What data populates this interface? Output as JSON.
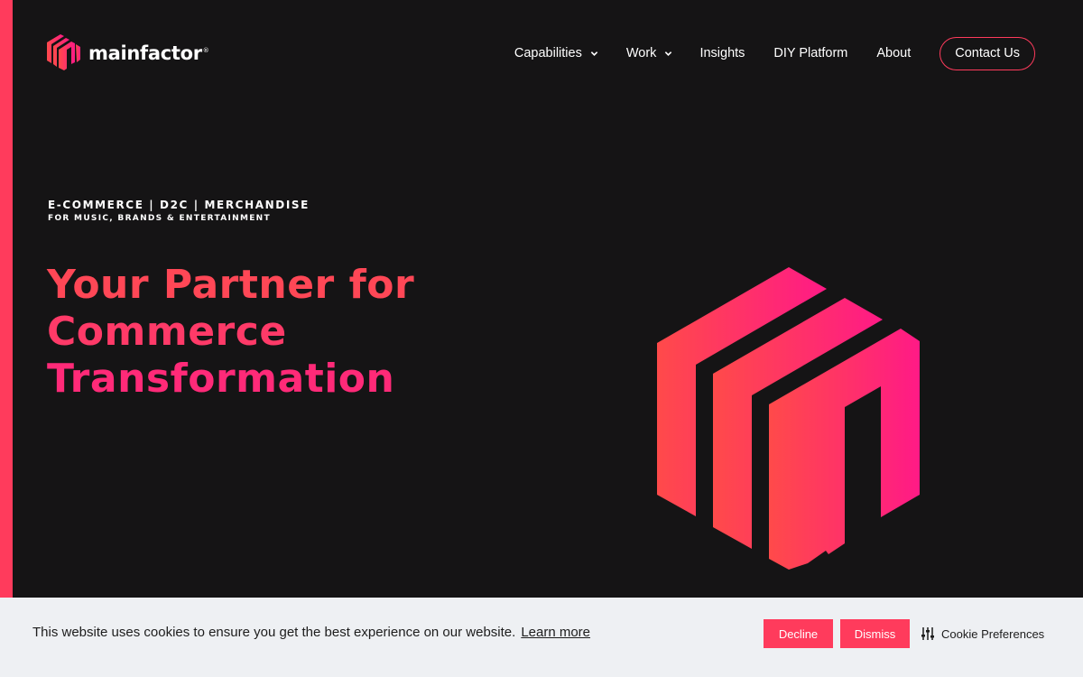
{
  "brand": {
    "name": "mainfactor",
    "mark": "®",
    "accent": "#ff3b5c",
    "gradient_from": "#ff4a4a",
    "gradient_to": "#ff1a86"
  },
  "nav": {
    "items": [
      {
        "label": "Capabilities",
        "has_dropdown": true
      },
      {
        "label": "Work",
        "has_dropdown": true
      },
      {
        "label": "Insights",
        "has_dropdown": false
      },
      {
        "label": "DIY Platform",
        "has_dropdown": false
      },
      {
        "label": "About",
        "has_dropdown": false
      }
    ],
    "contact_label": "Contact Us"
  },
  "hero": {
    "eyebrow_main": "E-COMMERCE | D2C | MERCHANDISE",
    "eyebrow_sub": "FOR MUSIC, BRANDS & ENTERTAINMENT",
    "title_lines": [
      "Your Partner for",
      "Commerce",
      "Transformation"
    ]
  },
  "cookie": {
    "message": "This website uses cookies to ensure you get the best experience on our website.",
    "learn_more": "Learn more",
    "decline": "Decline",
    "dismiss": "Dismiss",
    "preferences": "Cookie Preferences"
  },
  "icons": [
    "logo-mark-icon",
    "chevron-down-icon",
    "hero-logo-graphic",
    "sliders-icon"
  ]
}
